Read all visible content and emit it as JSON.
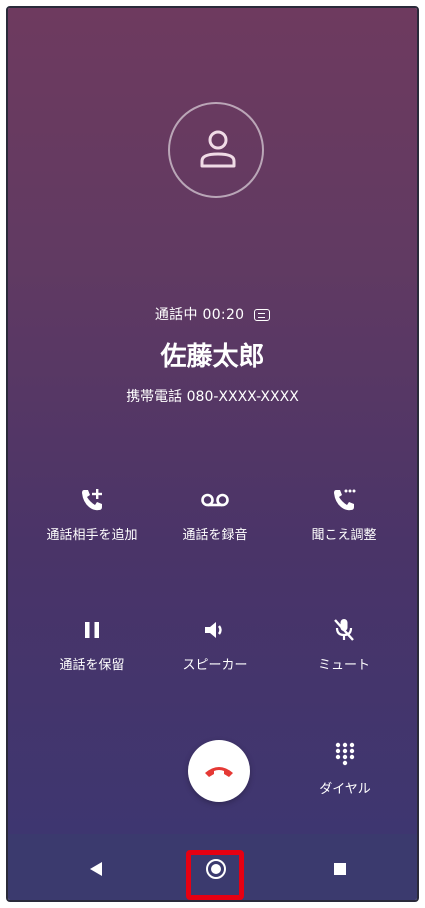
{
  "call": {
    "status": "通話中",
    "duration": "00:20",
    "caller_name": "佐藤太郎",
    "caller_number": "携帯電話 080-XXXX-XXXX"
  },
  "controls": {
    "add_call": "通話相手を追加",
    "record": "通話を録音",
    "hearing_adjust": "聞こえ調整",
    "hold": "通話を保留",
    "speaker": "スピーカー",
    "mute": "ミュート",
    "dialpad": "ダイヤル"
  },
  "colors": {
    "hangup_icon": "#e53935",
    "highlight": "#e60012",
    "navbar": "#3b3a6e"
  }
}
